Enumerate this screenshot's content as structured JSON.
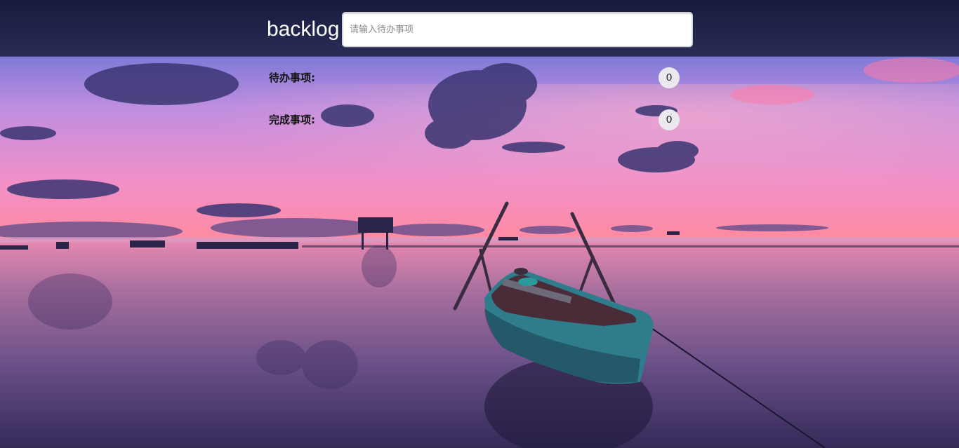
{
  "header": {
    "brand": "backlog",
    "todo_input": {
      "value": "",
      "placeholder": "请输入待办事项"
    }
  },
  "sections": {
    "pending": {
      "title": "待办事项:",
      "count": "0"
    },
    "done": {
      "title": "完成事项:",
      "count": "0"
    }
  },
  "background": {
    "subject": "sunset-lake-boat-photo",
    "colors": {
      "sky_top": "#2b2e6a",
      "sky_mid": "#b48ee6",
      "sky_horizon": "#ff86a6",
      "water": "#7a5a9a",
      "water_dark": "#3a2c5e",
      "boat_hull": "#2f7d8c"
    }
  }
}
